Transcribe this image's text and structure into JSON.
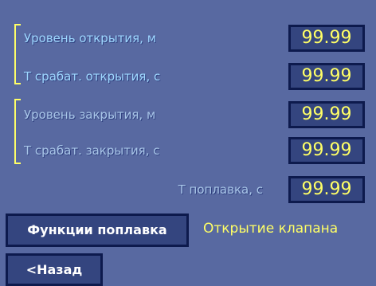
{
  "params": [
    {
      "label": "Уровень открытия, м",
      "value": "99.99"
    },
    {
      "label": "Т срабат. открытия, с",
      "value": "99.99"
    },
    {
      "label": "Уровень закрытия, м",
      "value": "99.99"
    },
    {
      "label": "Т срабат. закрытия, с",
      "value": "99.99"
    },
    {
      "label": "Т поплавка, с",
      "value": "99.99"
    }
  ],
  "float_functions_button": "Функции поплавка",
  "status_text": "Открытие клапана",
  "back_button": "<Назад",
  "colors": {
    "background": "#5869a1",
    "field": "#34457f",
    "accent": "#ffff66",
    "label": "#9fd8ff"
  }
}
